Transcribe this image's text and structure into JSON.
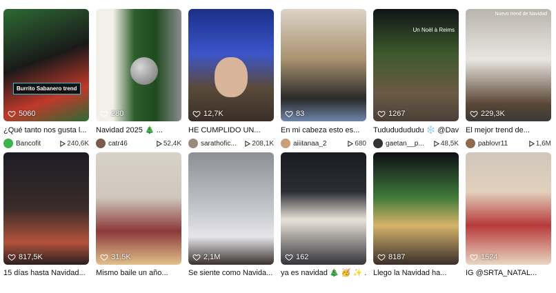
{
  "row1": [
    {
      "views": "5060",
      "title": "¿Qué tanto nos gusta l...",
      "author": "Bancofit",
      "plays": "240,6K",
      "tag": "Burrito Sabanero trend",
      "avatar_color": "#39b54a",
      "scene": [
        "#2d6b34",
        "#1a1a1a",
        "#c0392b"
      ]
    },
    {
      "views": "280",
      "title": "Navidad 2025 🎄 ...",
      "author": "catr46",
      "plays": "52,4K",
      "avatar_color": "#7a5c4d",
      "scene": [
        "#f3f0ea",
        "#2c5e2a",
        "#8c8c8c"
      ]
    },
    {
      "views": "12,7K",
      "title": "HE CUMPLIDO UN...",
      "author": "sarathofic...",
      "plays": "208,1K",
      "avatar_color": "#9a8b7c",
      "scene": [
        "#1b2f8a",
        "#3c55c9",
        "#5a4a3a"
      ]
    },
    {
      "views": "83",
      "title": "En mi cabeza esto es...",
      "author": "aiiitanaa_2",
      "plays": "680",
      "avatar_color": "#c9a07a",
      "scene": [
        "#dcd3c6",
        "#a8916f",
        "#2a2a2a"
      ]
    },
    {
      "views": "1267",
      "title": "Tudududududu ❄️ @Davi...",
      "author": "gaetan__p...",
      "plays": "48,5K",
      "caption": "Un Noël à Reims",
      "avatar_color": "#333333",
      "scene": [
        "#101518",
        "#3d5a2d",
        "#6c5a45"
      ]
    },
    {
      "views": "229,3K",
      "title": "El mejor trend de...",
      "author": "pablovr11",
      "plays": "1,6M",
      "caption": "Nuevo trend de Navidad",
      "avatar_color": "#8e6b4f",
      "scene": [
        "#b9b5ad",
        "#e9e6e0",
        "#5a4535"
      ]
    }
  ],
  "row2": [
    {
      "views": "817,5K",
      "title": "15 días hasta Navidad...",
      "scene": [
        "#1d1c24",
        "#3a2c2a",
        "#b3533a"
      ]
    },
    {
      "views": "31,5K",
      "title": "Mismo baile un año...",
      "scene": [
        "#d8d2c7",
        "#8b3a3a",
        "#e0c08a"
      ]
    },
    {
      "views": "2,1M",
      "title": "Se siente como Navida...",
      "scene": [
        "#8d8f96",
        "#c4c6cc",
        "#3a3030"
      ]
    },
    {
      "views": "162",
      "title": "ya es navidad 🎄 🥳 ✨ ...",
      "scene": [
        "#1a1c22",
        "#e8e2d8",
        "#34343a"
      ]
    },
    {
      "views": "8187",
      "title": "Llego la Navidad ha...",
      "scene": [
        "#0e0e14",
        "#3f7a3a",
        "#d6b36a"
      ]
    },
    {
      "views": "1524",
      "title": "IG @SRTA_NATAL...",
      "scene": [
        "#cfc6ba",
        "#b83a3a",
        "#e8d6c2"
      ]
    }
  ]
}
